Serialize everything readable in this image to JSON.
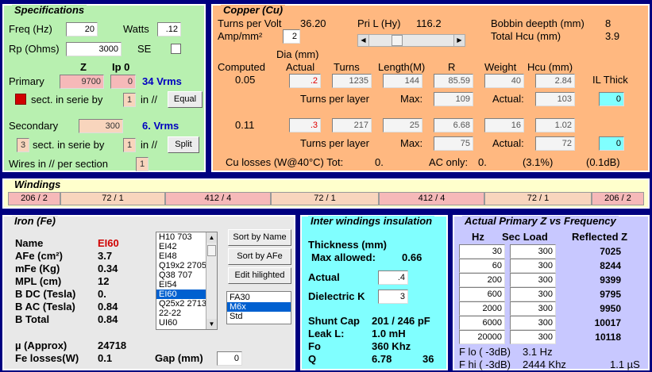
{
  "specs": {
    "title": "Specifications",
    "freq_label": "Freq (Hz)",
    "freq": "20",
    "watts_label": "Watts",
    "watts": ".12",
    "rp_label": "Rp (Ohms)",
    "rp": "3000",
    "se_label": "SE",
    "z_label": "Z",
    "ip_label": "Ip 0",
    "primary_label": "Primary",
    "primary_z": "9700",
    "primary_ip": "0",
    "primary_vrms": "34 Vrms",
    "sect_label": "sect. in serie by",
    "in_par": "in //",
    "primary_serie": "1",
    "equal_btn": "Equal",
    "secondary_label": "Secondary",
    "secondary_z": "300",
    "secondary_vrms": "6. Vrms",
    "secondary_sect": "3",
    "secondary_serie": "1",
    "split_btn": "Split",
    "wires_label": "Wires in // per section",
    "wires": "1"
  },
  "copper": {
    "title": "Copper (Cu)",
    "tpv_label": "Turns per Volt",
    "tpv": "36.20",
    "pril_label": "Pri L (Hy)",
    "pril": "116.2",
    "bobbin_label": "Bobbin deepth (mm)",
    "bobbin": "8",
    "amp_label": "Amp/mm²",
    "amp": "2",
    "totalhcu_label": "Total Hcu (mm)",
    "totalhcu": "3.9",
    "dia_label": "Dia (mm)",
    "headers": [
      "Computed",
      "Actual",
      "Turns",
      "Length(M)",
      "R",
      "Weight",
      "Hcu (mm)",
      "IL Thick"
    ],
    "tpl_label": "Turns per layer",
    "max_label": "Max:",
    "actual_label": "Actual:",
    "rows": [
      {
        "computed": "0.05",
        "actual": ".2",
        "turns": "1235",
        "length": "144",
        "r": "85.59",
        "weight": "40",
        "hcu": "2.84",
        "max": "109",
        "act": "103",
        "il": "0"
      },
      {
        "computed": "0.11",
        "actual": ".3",
        "turns": "217",
        "length": "25",
        "r": "6.68",
        "weight": "16",
        "hcu": "1.02",
        "max": "75",
        "act": "72",
        "il": "0"
      }
    ],
    "losses_label": "Cu losses (W@40°C) Tot:",
    "losses_tot": "0.",
    "ac_label": "AC only:",
    "ac": "0.",
    "pct": "(3.1%)",
    "db": "(0.1dB)"
  },
  "windings": {
    "title": "Windings",
    "cells": [
      "206 / 2",
      "72 / 1",
      "412 / 4",
      "72 / 1",
      "412 / 4",
      "72 / 1",
      "206 / 2"
    ]
  },
  "iron": {
    "title": "Iron (Fe)",
    "name_label": "Name",
    "name": "EI60",
    "afe_label": "AFe (cm²)",
    "afe": "3.7",
    "mfe_label": "mFe (Kg)",
    "mfe": "0.34",
    "mpl_label": "MPL (cm)",
    "mpl": "12",
    "bdc_label": "B DC (Tesla)",
    "bdc": "0.",
    "bac_label": "B AC (Tesla)",
    "bac": "0.84",
    "btot_label": "B Total",
    "btot": "0.84",
    "mu_label": "µ (Approx)",
    "mu": "24718",
    "felosses_label": "Fe losses(W)",
    "felosses": "0.1",
    "gap_label": "Gap (mm)",
    "gap": "0",
    "cores": [
      "H10  703",
      "EI42",
      "EI48",
      "Q19x2 2705",
      "Q38  707",
      "EI54",
      "EI60",
      "Q25x2 2713",
      "22-22",
      "UI60"
    ],
    "selected_core": "EI60",
    "sort_name_btn": "Sort by Name",
    "sort_afe_btn": "Sort by AFe",
    "edit_btn": "Edit hilighted",
    "materials": [
      "FA30",
      "M6x",
      "Std"
    ],
    "selected_material": "M6x"
  },
  "insulation": {
    "title": "Inter windings insulation",
    "thickness_label": "Thickness (mm)",
    "maxallowed_label": "Max allowed:",
    "maxallowed": "0.66",
    "actual_label": "Actual",
    "actual": ".4",
    "dielectric_label": "Dielectric K",
    "dielectric": "3",
    "shunt_label": "Shunt Cap",
    "shunt": "201 / 246 pF",
    "leak_label": "Leak L:",
    "leak": "1.0 mH",
    "fo_label": "Fo",
    "fo": "360 Khz",
    "q_label": "Q",
    "q": "6.78",
    "q2": "36"
  },
  "freqz": {
    "title": "Actual Primary Z vs Frequency",
    "hz_label": "Hz",
    "secload_label": "Sec Load",
    "refl_label": "Reflected Z",
    "rows": [
      {
        "hz": "30",
        "load": "300",
        "z": "7025"
      },
      {
        "hz": "60",
        "load": "300",
        "z": "8244"
      },
      {
        "hz": "200",
        "load": "300",
        "z": "9399"
      },
      {
        "hz": "600",
        "load": "300",
        "z": "9795"
      },
      {
        "hz": "2000",
        "load": "300",
        "z": "9950"
      },
      {
        "hz": "6000",
        "load": "300",
        "z": "10017"
      },
      {
        "hz": "20000",
        "load": "300",
        "z": "10118"
      }
    ],
    "flo_label": "F lo ( -3dB)",
    "flo": "3.1 Hz",
    "fhi_label": "F hi ( -3dB)",
    "fhi": "2444 Khz",
    "rise": "1.1 µS"
  }
}
